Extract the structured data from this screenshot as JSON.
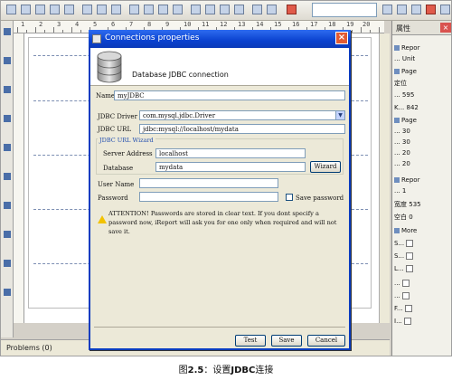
{
  "ruler": {
    "numbers": [
      "1",
      "2",
      "3",
      "4",
      "5",
      "6",
      "7",
      "8",
      "9",
      "10",
      "11",
      "12",
      "13",
      "14",
      "15",
      "16",
      "17",
      "18",
      "19",
      "20"
    ]
  },
  "bottom_panel": {
    "problems_tab": "Problems (0)"
  },
  "properties_panel": {
    "title": "属性",
    "rows": [
      "Repor",
      "...",
      "Unit",
      "Page",
      "定位",
      "...",
      "595",
      "K...",
      "842",
      "Page",
      "...",
      "30",
      "...",
      "30",
      "...",
      "20",
      "...",
      "20",
      "Repor",
      "...",
      "1",
      "宽度",
      "535",
      "空白",
      "0",
      "More",
      "S...",
      "S...",
      "L...",
      "...",
      "...",
      "F...",
      "I..."
    ]
  },
  "dialog": {
    "title": "Connections properties",
    "close_glyph": "×",
    "heading": "Database JDBC connection",
    "name_label": "Name",
    "name_value": "myJDBC",
    "driver_label": "JDBC Driver",
    "driver_value": "com.mysql.jdbc.Driver",
    "url_label": "JDBC URL",
    "url_value": "jdbc:mysql://localhost/mydata",
    "wizard_legend": "JDBC URL Wizard",
    "server_label": "Server Address",
    "server_value": "localhost",
    "database_label": "Database",
    "database_value": "mydata",
    "wizard_button": "Wizard",
    "user_label": "User Name",
    "user_value": "",
    "password_label": "Password",
    "password_value": "",
    "save_password_label": "Save password",
    "warning": "ATTENTION! Passwords are stored in clear text. If you dont specify a password now, iReport will ask you for one only when required and will not save it.",
    "test_button": "Test",
    "save_button": "Save",
    "cancel_button": "Cancel"
  },
  "caption": {
    "prefix": "图",
    "number": "2.5",
    "text_1": "：设置",
    "bold": "JDBC",
    "text_2": "连接"
  }
}
